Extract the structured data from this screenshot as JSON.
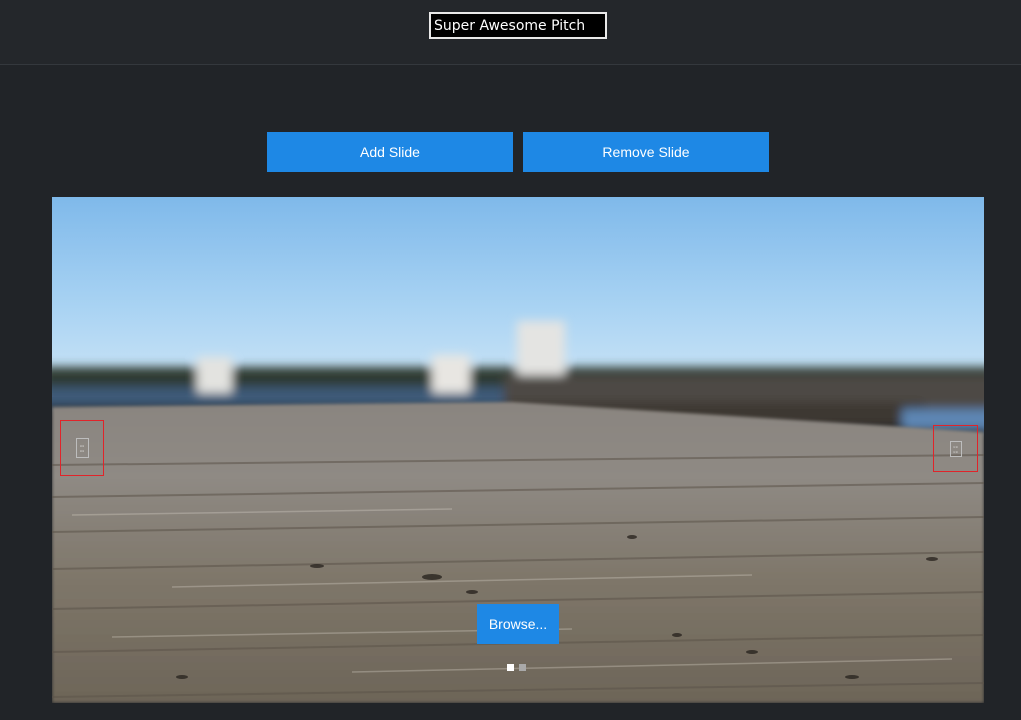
{
  "header": {
    "pitch_title_value": "Super Awesome Pitch"
  },
  "toolbar": {
    "add_slide_label": "Add Slide",
    "remove_slide_label": "Remove Slide"
  },
  "slide": {
    "background_image": "blurred wooden dock over water",
    "prev_arrow_icon": "broken-image-icon",
    "next_arrow_icon": "broken-image-icon",
    "browse_label": "Browse..."
  },
  "pagination": {
    "total": 2,
    "active_index": 0
  },
  "colors": {
    "accent": "#1e88e5",
    "page_background": "#212428",
    "arrow_border": "#e0242a"
  }
}
